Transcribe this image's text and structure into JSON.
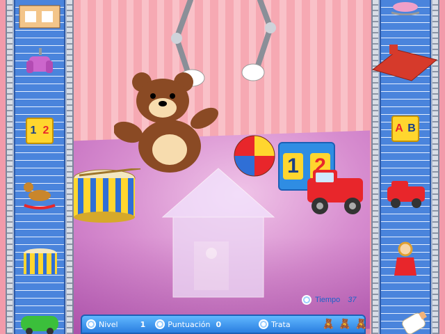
{
  "hud": {
    "level_label": "Nivel",
    "level_value": "1",
    "score_label": "Puntuación",
    "score_value": "0",
    "tries_label": "Trata",
    "tries_icons": [
      "teddy-icon",
      "teddy-icon",
      "teddy-icon"
    ]
  },
  "timer": {
    "label": "Tiempo",
    "value": "37"
  },
  "blocks": {
    "left_digits": [
      "1",
      "2"
    ],
    "right_letters": [
      "A",
      "B"
    ],
    "big_digits": [
      "1",
      "2"
    ]
  },
  "colors": {
    "wall_stripe_a": "#f6a9b3",
    "wall_stripe_b": "#f9c1c8",
    "floor": "#d78dcf",
    "belt": "#4a84dc",
    "hud": "#2a7ee0"
  }
}
